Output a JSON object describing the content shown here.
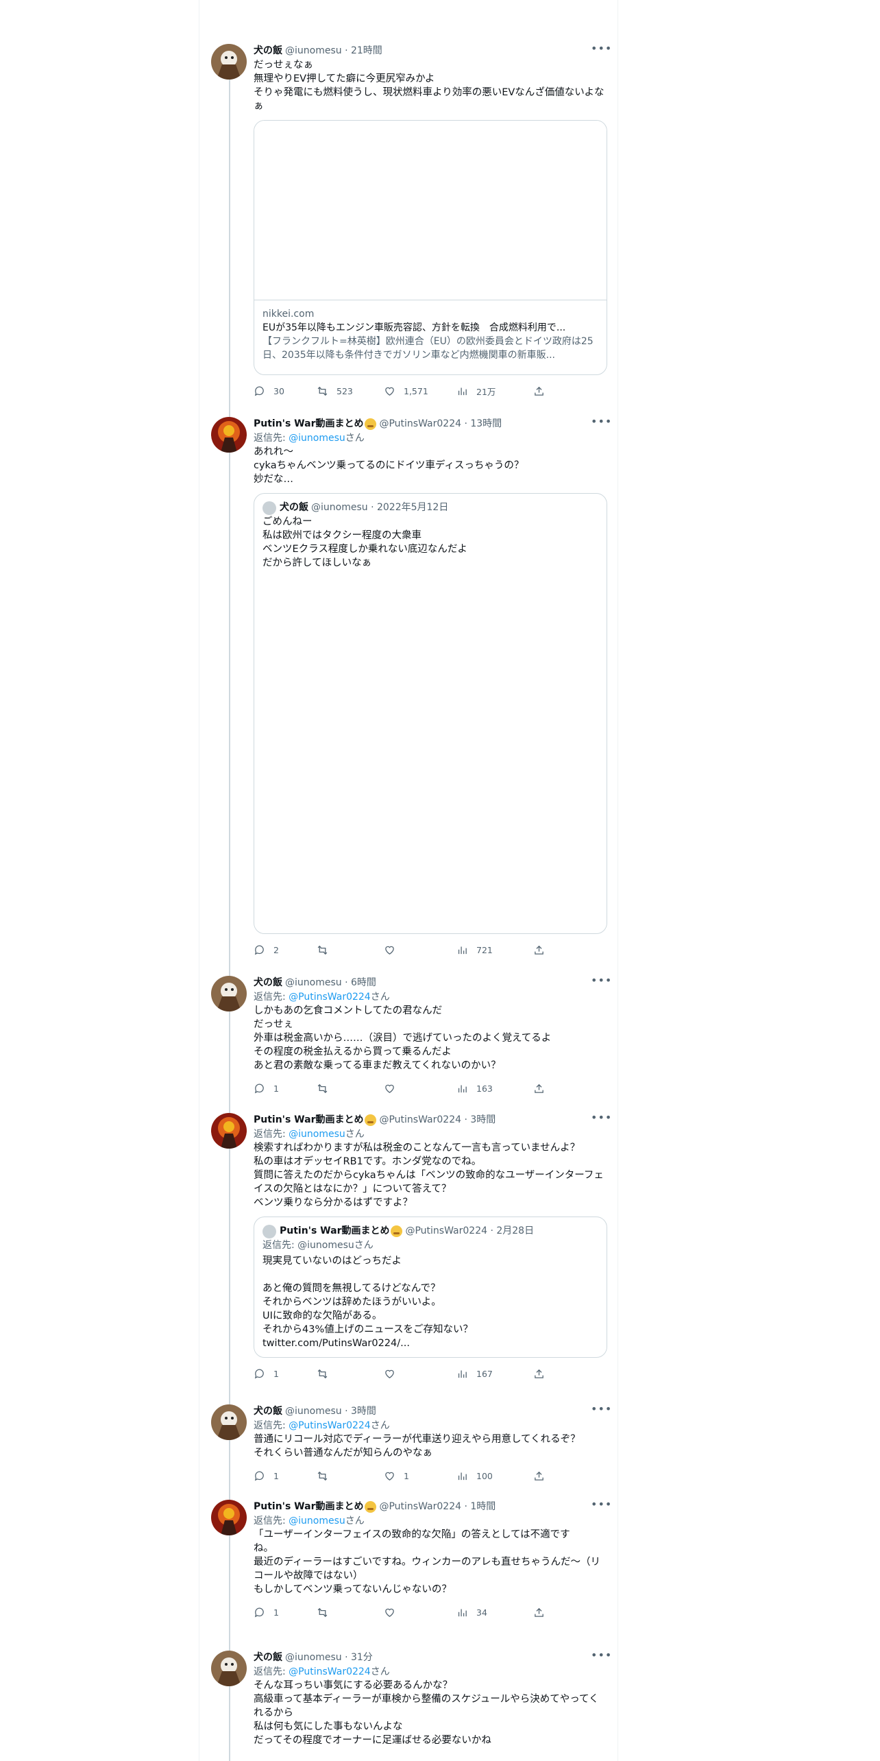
{
  "tweets": [
    {
      "id": "t1",
      "name": "犬の飯",
      "handle": "@iunomesu · 21時間",
      "text": "だっせぇなぁ\n無理やりEV押してた癖に今更尻窄みかよ\nそりゃ発電にも燃料使うし、現状燃料車より効率の悪いEVなんざ価値ないよなぁ",
      "card": {
        "domain": "nikkei.com",
        "title": "EUが35年以降もエンジン車販売容認、方針を転換　合成燃料利用で...",
        "desc": "【フランクフルト=林英樹】欧州連合（EU）の欧州委員会とドイツ政府は25日、2035年以降も条件付きでガソリン車など内燃機関車の新車販..."
      },
      "stats": {
        "replies": "30",
        "retweets": "523",
        "likes": "1,571",
        "views": "21万"
      }
    },
    {
      "id": "t2",
      "name": "Putin's War動画まとめ",
      "emoji": true,
      "handle": "@PutinsWar0224 · 13時間",
      "replyto_prefix": "返信先: ",
      "replyto": "@iunomesu",
      "replyto_suffix": "さん",
      "text": "あれれ～\ncykaちゃんベンツ乗ってるのにドイツ車ディスっちゃうの？\n妙だな…",
      "quote": {
        "name": "犬の飯",
        "handle": "@iunomesu · 2022年5月12日",
        "text": "ごめんねー\n私は欧州ではタクシー程度の大衆車\nベンツEクラス程度しか乗れない底辺なんだよ\nだから許してほしいなぁ"
      },
      "stats": {
        "replies": "2",
        "retweets": "",
        "likes": "",
        "views": "721"
      }
    },
    {
      "id": "t3",
      "name": "犬の飯",
      "handle": "@iunomesu · 6時間",
      "replyto_prefix": "返信先: ",
      "replyto": "@PutinsWar0224",
      "replyto_suffix": "さん",
      "text": "しかもあの乞食コメントしてたの君なんだ\nだっせぇ\n外車は税金高いから……（涙目）で逃げていったのよく覚えてるよ\nその程度の税金払えるから買って乗るんだよ\nあと君の素敵な乗ってる車まだ教えてくれないのかい？",
      "stats": {
        "replies": "1",
        "retweets": "",
        "likes": "",
        "views": "163"
      }
    },
    {
      "id": "t4",
      "name": "Putin's War動画まとめ",
      "emoji": true,
      "handle": "@PutinsWar0224 · 3時間",
      "replyto_prefix": "返信先: ",
      "replyto": "@iunomesu",
      "replyto_suffix": "さん",
      "text": "検索すればわかりますが私は税金のことなんて一言も言っていませんよ？\n私の車はオデッセイRB1です。ホンダ党なのでね。\n質問に答えたのだからcykaちゃんは「ベンツの致命的なユーザーインターフェイスの欠陥とはなにか？」について答えて？\nベンツ乗りなら分かるはずですよ？",
      "quote": {
        "name": "Putin's War動画まとめ",
        "emoji": true,
        "handle": "@PutinsWar0224 · 2月28日",
        "replyto_prefix": "返信先: ",
        "replyto": "@iunomesu",
        "replyto_suffix": "さん",
        "text": "現実見ていないのはどっちだよ\n\nあと俺の質問を無視してるけどなんで？\nそれからベンツは辞めたほうがいいよ。\nUIに致命的な欠陥がある。\nそれから43%値上げのニュースをご存知ない？\ntwitter.com/PutinsWar0224/..."
      },
      "stats": {
        "replies": "1",
        "retweets": "",
        "likes": "",
        "views": "167"
      }
    },
    {
      "id": "t5",
      "name": "犬の飯",
      "handle": "@iunomesu · 3時間",
      "replyto_prefix": "返信先: ",
      "replyto": "@PutinsWar0224",
      "replyto_suffix": "さん",
      "text": "普通にリコール対応でディーラーが代車送り迎えやら用意してくれるぞ？\nそれくらい普通なんだが知らんのやなぁ",
      "stats": {
        "replies": "1",
        "retweets": "",
        "likes": "1",
        "views": "100"
      }
    },
    {
      "id": "t6",
      "name": "Putin's War動画まとめ",
      "emoji": true,
      "handle": "@PutinsWar0224 · 1時間",
      "replyto_prefix": "返信先: ",
      "replyto": "@iunomesu",
      "replyto_suffix": "さん",
      "text": "「ユーザーインターフェイスの致命的な欠陥」の答えとしては不適です\nね。\n最近のディーラーはすごいですね。ウィンカーのアレも直せちゃうんだ～（リコールや故障ではない）\nもしかしてベンツ乗ってないんじゃないの？",
      "stats": {
        "replies": "1",
        "retweets": "",
        "likes": "",
        "views": "34"
      }
    },
    {
      "id": "t7",
      "name": "犬の飯",
      "handle": "@iunomesu · 31分",
      "replyto_prefix": "返信先: ",
      "replyto": "@PutinsWar0224",
      "replyto_suffix": "さん",
      "text": "そんな耳っちい事気にする必要あるんかな？\n高級車って基本ディーラーが車検から整備のスケジュールやら決めてやってくれるから\n私は何も気にした事もないんよな\nだってその程度でオーナーに足運ばせる必要ないかね",
      "stats": {
        "replies": "",
        "retweets": "",
        "likes": "",
        "views": ""
      }
    }
  ],
  "colors": {
    "text": "#0f1419",
    "secondary": "#536471",
    "link": "#1d9bf0",
    "border": "#cfd9de"
  }
}
